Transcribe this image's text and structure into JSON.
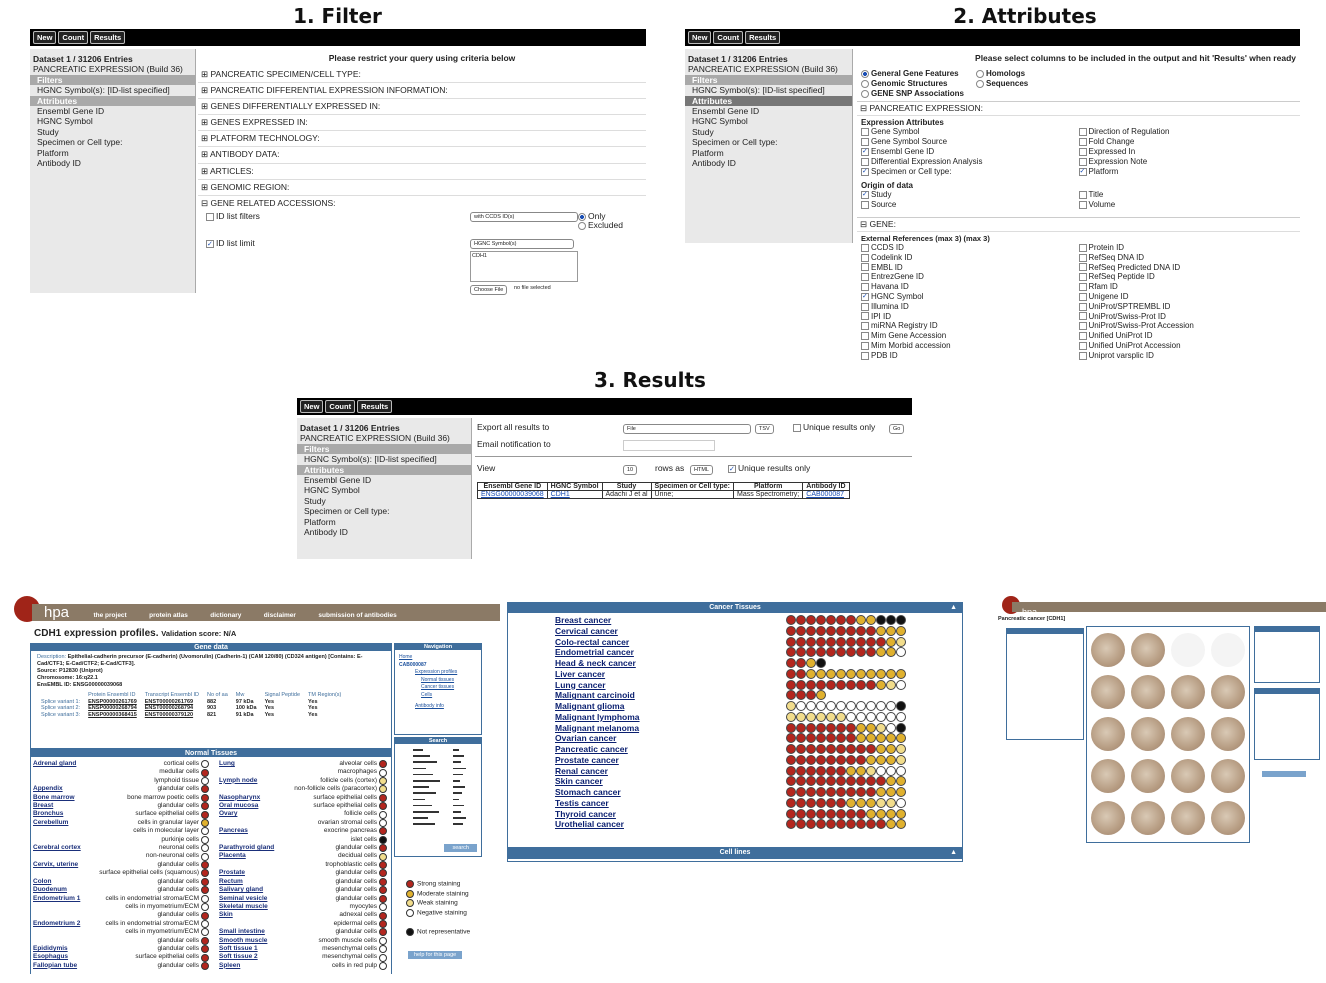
{
  "titles": {
    "p1": "1. Filter",
    "p2": "2. Attributes",
    "p3": "3. Results"
  },
  "toolbar": {
    "new": "New",
    "count": "Count",
    "results": "Results"
  },
  "sidebar": {
    "dataset": "Dataset 1 / 31206 Entries",
    "db": "PANCREATIC EXPRESSION (Build 36)",
    "filters": "Filters",
    "filter_item": "HGNC Symbol(s): [ID-list specified]",
    "attributes": "Attributes",
    "attr_items": [
      "Ensembl Gene ID",
      "HGNC Symbol",
      "Study",
      "Specimen or Cell type:",
      "Platform",
      "Antibody ID"
    ]
  },
  "filter": {
    "caption": "Please restrict your query using criteria below",
    "sections": [
      "PANCREATIC SPECIMEN/CELL TYPE:",
      "PANCREATIC DIFFERENTIAL EXPRESSION INFORMATION:",
      "GENES DIFFERENTIALLY EXPRESSED IN:",
      "GENES EXPRESSED IN:",
      "PLATFORM TECHNOLOGY:",
      "ANTIBODY DATA:",
      "ARTICLES:",
      "GENOMIC REGION:",
      "GENE RELATED ACCESSIONS:"
    ],
    "id_list_filters": "ID list filters",
    "id_list_select": "with CCDS ID(s)",
    "only": "Only",
    "excluded": "Excluded",
    "id_list_limit": "ID list limit",
    "hgnc_select": "HGNC Symbol(s)",
    "textarea_value": "CDH1",
    "choose_file": "Choose File",
    "no_file": "no file selected"
  },
  "attributes": {
    "caption": "Please select columns to be included in the output and hit 'Results' when ready",
    "radios": [
      "General Gene Features",
      "Genomic Structures",
      "GENE SNP Associations",
      "Homologs",
      "Sequences"
    ],
    "pancreatic": "PANCREATIC EXPRESSION:",
    "expr_title": "Expression Attributes",
    "expr_left": [
      [
        "Gene Symbol",
        false
      ],
      [
        "Gene Symbol Source",
        false
      ],
      [
        "Ensembl Gene ID",
        true
      ],
      [
        "Differential Expression Analysis",
        false
      ],
      [
        "Specimen or Cell type:",
        true
      ]
    ],
    "expr_right": [
      [
        "Direction of Regulation",
        false
      ],
      [
        "Fold Change",
        false
      ],
      [
        "Expressed In",
        false
      ],
      [
        "Expression Note",
        false
      ],
      [
        "Platform",
        true
      ]
    ],
    "origin_title": "Origin of data",
    "origin_left": [
      [
        "Study",
        true
      ],
      [
        "Source",
        false
      ]
    ],
    "origin_right": [
      [
        "Title",
        false
      ],
      [
        "Volume",
        false
      ]
    ],
    "gene": "GENE:",
    "ext_title": "External References (max 3) (max 3)",
    "ext_left": [
      [
        "CCDS ID",
        false
      ],
      [
        "Codelink ID",
        false
      ],
      [
        "EMBL ID",
        false
      ],
      [
        "EntrezGene ID",
        false
      ],
      [
        "Havana ID",
        false
      ],
      [
        "HGNC Symbol",
        true
      ],
      [
        "Illumina ID",
        false
      ],
      [
        "IPI ID",
        false
      ],
      [
        "miRNA Registry ID",
        false
      ],
      [
        "Mim Gene Accession",
        false
      ],
      [
        "Mim Morbid accession",
        false
      ],
      [
        "PDB ID",
        false
      ]
    ],
    "ext_right": [
      [
        "Protein ID",
        false
      ],
      [
        "RefSeq DNA ID",
        false
      ],
      [
        "RefSeq Predicted DNA ID",
        false
      ],
      [
        "RefSeq Peptide ID",
        false
      ],
      [
        "Rfam ID",
        false
      ],
      [
        "Unigene ID",
        false
      ],
      [
        "UniProt/SPTREMBL ID",
        false
      ],
      [
        "UniProt/Swiss-Prot ID",
        false
      ],
      [
        "UniProt/Swiss-Prot Accession",
        false
      ],
      [
        "Unified UniProt ID",
        false
      ],
      [
        "Unified UniProt Accession",
        false
      ],
      [
        "Uniprot varsplic ID",
        false
      ]
    ]
  },
  "results": {
    "export": "Export  all results to",
    "file": "File",
    "tsv": "TSV",
    "unique": "Unique results only",
    "go": "Go",
    "email": "Email notification to",
    "view": "View",
    "rows": "10",
    "rows_as": "rows as",
    "html": "HTML",
    "unique2": "Unique results only",
    "headers": [
      "Ensembl Gene ID",
      "HGNC Symbol",
      "Study",
      "Specimen or Cell type:",
      "Platform",
      "Antibody ID"
    ],
    "row": [
      "ENSG00000039068",
      "CDH1",
      "Adachi J et al",
      "Urine;",
      "Mass Spectrometry;",
      "CAB000087"
    ]
  },
  "hpa": {
    "logo": "hpa",
    "nav": [
      "the project",
      "protein atlas",
      "dictionary",
      "disclaimer",
      "submission of antibodies"
    ],
    "title": "CDH1 expression profiles.",
    "score": "Validation score: N/A",
    "gene_data": "Gene data",
    "description_label": "Description:",
    "description": "Epithelial-cadherin precursor (E-cadherin) (Uvomorulin) (Cadherin-1) (CAM 120/80) (CD324 antigen) [Contains: E-Cad/CTF1; E-Cad/CTF2; E-Cad/CTF3].",
    "source": "Source: P12830 (Uniprot)",
    "chromosome": "Chromosome: 16:q22.1",
    "ensembl": "EnsEMBL ID: ENSG00000039068",
    "splice_headers": [
      "Protein Ensembl ID",
      "Transcript Ensembl ID",
      "No of aa",
      "Mw",
      "Signal Peptide",
      "TM Region(s)"
    ],
    "splice": [
      [
        "Splice variant 1:",
        "ENSP00000261769",
        "ENST00000261769",
        "882",
        "97 kDa",
        "Yes",
        "Yes"
      ],
      [
        "Splice variant 2:",
        "ENSP00000268794",
        "ENST00000268794",
        "903",
        "100 kDa",
        "Yes",
        "Yes"
      ],
      [
        "Splice variant 3:",
        "ENSP00000368415",
        "ENST00000379120",
        "821",
        "91 kDa",
        "Yes",
        "Yes"
      ]
    ],
    "normal_tissues": "Normal Tissues",
    "navigation": "Navigation",
    "nav_home": "Home",
    "nav_cab": "CAB000087",
    "nav_ep": "Expression profiles",
    "nav_nt": "Normal tissues",
    "nav_ct": "Cancer tissues",
    "nav_cells": "Cells",
    "nav_ab": "Antibody info",
    "search": "Search",
    "search_btn": "search",
    "help": "help for this page",
    "legend": [
      "Strong staining",
      "Moderate staining",
      "Weak staining",
      "Negative staining",
      "Not representative"
    ],
    "tissues_left": [
      [
        "Adrenal gland",
        "cortical cells",
        "n"
      ],
      [
        "",
        "medullar cells",
        "s"
      ],
      [
        "",
        "lymphoid tissue",
        "n"
      ],
      [
        "Appendix",
        "glandular cells",
        "s"
      ],
      [
        "Bone marrow",
        "bone marrow poetic cells",
        "s"
      ],
      [
        "Breast",
        "glandular cells",
        "s"
      ],
      [
        "Bronchus",
        "surface epithelial cells",
        "s"
      ],
      [
        "Cerebellum",
        "cells in granular layer",
        "m"
      ],
      [
        "",
        "cells in molecular layer",
        "n"
      ],
      [
        "",
        "purkinje cells",
        "n"
      ],
      [
        "Cerebral cortex",
        "neuronal cells",
        "n"
      ],
      [
        "",
        "non-neuronal cells",
        "n"
      ],
      [
        "Cervix, uterine",
        "glandular cells",
        "s"
      ],
      [
        "",
        "surface epithelial cells (squamous)",
        "s"
      ],
      [
        "Colon",
        "glandular cells",
        "s"
      ],
      [
        "Duodenum",
        "glandular cells",
        "s"
      ],
      [
        "Endometrium 1",
        "cells in endometrial stroma/ECM",
        "n"
      ],
      [
        "",
        "cells in myometrium/ECM",
        "n"
      ],
      [
        "",
        "glandular cells",
        "s"
      ],
      [
        "Endometrium 2",
        "cells in endometrial stroma/ECM",
        "n"
      ],
      [
        "",
        "cells in myometrium/ECM",
        "n"
      ],
      [
        "",
        "glandular cells",
        "s"
      ],
      [
        "Epididymis",
        "glandular cells",
        "s"
      ],
      [
        "Esophagus",
        "surface epithelial cells",
        "s"
      ],
      [
        "Fallopian tube",
        "glandular cells",
        "s"
      ]
    ],
    "tissues_right": [
      [
        "Lung",
        "alveolar cells",
        "s"
      ],
      [
        "",
        "macrophages",
        "n"
      ],
      [
        "Lymph node",
        "follicle cells (cortex)",
        "w"
      ],
      [
        "",
        "non-follicle cells (paracortex)",
        "w"
      ],
      [
        "Nasopharynx",
        "surface epithelial cells",
        "s"
      ],
      [
        "Oral mucosa",
        "surface epithelial cells",
        "s"
      ],
      [
        "Ovary",
        "follicle cells",
        "n"
      ],
      [
        "",
        "ovarian stromal cells",
        "n"
      ],
      [
        "Pancreas",
        "exocrine pancreas",
        "s"
      ],
      [
        "",
        "islet cells",
        "x"
      ],
      [
        "Parathyroid gland",
        "glandular cells",
        "s"
      ],
      [
        "Placenta",
        "decidual cells",
        "w"
      ],
      [
        "",
        "trophoblastic cells",
        "s"
      ],
      [
        "Prostate",
        "glandular cells",
        "s"
      ],
      [
        "Rectum",
        "glandular cells",
        "s"
      ],
      [
        "Salivary gland",
        "glandular cells",
        "s"
      ],
      [
        "Seminal vesicle",
        "glandular cells",
        "s"
      ],
      [
        "Skeletal muscle",
        "myocytes",
        "n"
      ],
      [
        "Skin",
        "adnexal cells",
        "s"
      ],
      [
        "",
        "epidermal cells",
        "s"
      ],
      [
        "Small intestine",
        "glandular cells",
        "s"
      ],
      [
        "Smooth muscle",
        "smooth muscle cells",
        "n"
      ],
      [
        "Soft tissue 1",
        "mesenchymal cells",
        "n"
      ],
      [
        "Soft tissue 2",
        "mesenchymal cells",
        "n"
      ],
      [
        "Spleen",
        "cells in red pulp",
        "n"
      ]
    ],
    "cancer_tissues": "Cancer Tissues",
    "cell_lines": "Cell lines",
    "cancers": [
      "Breast cancer",
      "Cervical cancer",
      "Colo-rectal cancer",
      "Endometrial cancer",
      "Head & neck cancer",
      "Liver cancer",
      "Lung cancer",
      "Malignant carcinoid",
      "Malignant glioma",
      "Malignant lymphoma",
      "Malignant melanoma",
      "Ovarian cancer",
      "Pancreatic cancer",
      "Prostate cancer",
      "Renal cancer",
      "Skin cancer",
      "Stomach cancer",
      "Testis cancer",
      "Thyroid cancer",
      "Urothelial cancer"
    ],
    "cancer_dots": [
      "sssssssmmkkk",
      "sssssssssmmm",
      "ssssssssssmw",
      "sssssssssmmn",
      "ssmk",
      "ssmmmmmmmmmm",
      "sssssssssmwn",
      "sssm",
      "wnnnnnnnnnnk",
      "wwwwwwnnnnnn",
      "sssssssmmwnk",
      "sssssssmmmmm",
      "sssssssssmmw",
      "ssssssssmmmw",
      "ssssssmmwnnn",
      "ssssssssssmm",
      "sssssssssmmm",
      "ssssssmmmwwn",
      "ssssssssmmmm",
      "ssssssssssmm"
    ],
    "mini_title": "Pancreatic cancer [CDH1]",
    "colors": {
      "strong": "#b3261e",
      "moderate": "#e0b12e",
      "weak": "#f2dd8c",
      "negative": "#ffffff",
      "notrep": "#111111",
      "bar": "#8b7a66",
      "blue": "#3f6e9c"
    }
  }
}
